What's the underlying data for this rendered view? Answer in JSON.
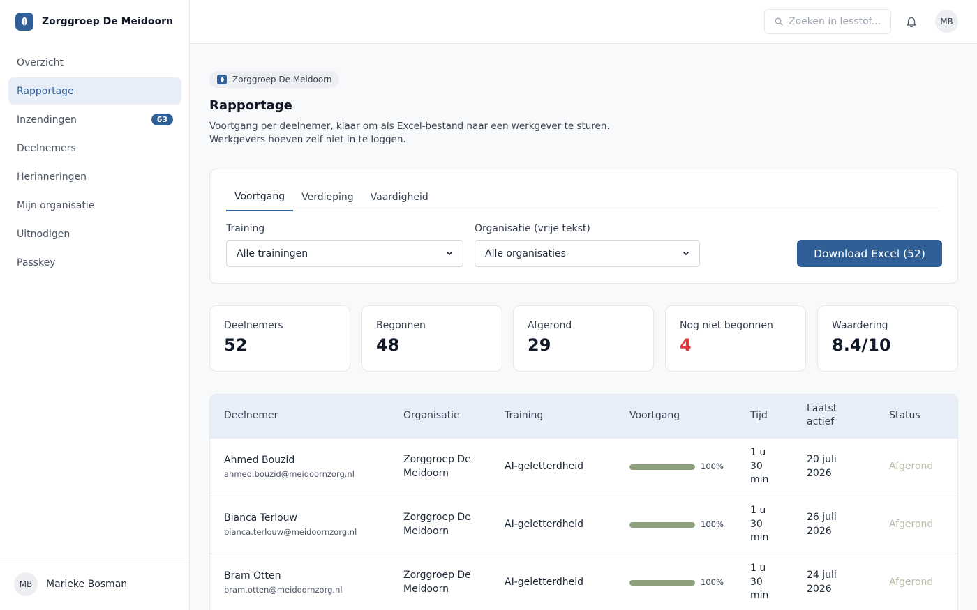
{
  "brand": {
    "name": "Zorggroep De Meidoorn"
  },
  "sidebar": {
    "items": [
      {
        "label": "Overzicht"
      },
      {
        "label": "Rapportage"
      },
      {
        "label": "Inzendingen",
        "badge": "63"
      },
      {
        "label": "Deelnemers"
      },
      {
        "label": "Herinneringen"
      },
      {
        "label": "Mijn organisatie"
      },
      {
        "label": "Uitnodigen"
      },
      {
        "label": "Passkey"
      }
    ],
    "user": {
      "initials": "MB",
      "name": "Marieke Bosman"
    }
  },
  "topbar": {
    "search_placeholder": "Zoeken in lesstof...",
    "avatar_initials": "MB"
  },
  "page": {
    "org_chip": "Zorggroep De Meidoorn",
    "title": "Rapportage",
    "desc_line1": "Voortgang per deelnemer, klaar om als Excel-bestand naar een werkgever te sturen.",
    "desc_line2": "Werkgevers hoeven zelf niet in te loggen."
  },
  "panel": {
    "tabs": [
      {
        "label": "Voortgang"
      },
      {
        "label": "Verdieping"
      },
      {
        "label": "Vaardigheid"
      }
    ],
    "training_label": "Training",
    "training_value": "Alle trainingen",
    "org_label": "Organisatie (vrije tekst)",
    "org_value": "Alle organisaties",
    "download_label": "Download Excel (52)"
  },
  "stats": [
    {
      "label": "Deelnemers",
      "value": "52"
    },
    {
      "label": "Begonnen",
      "value": "48"
    },
    {
      "label": "Afgerond",
      "value": "29"
    },
    {
      "label": "Nog niet begonnen",
      "value": "4"
    },
    {
      "label": "Waardering",
      "value": "8.4/10"
    }
  ],
  "table": {
    "headers": {
      "deelnemer": "Deelnemer",
      "organisatie": "Organisatie",
      "training": "Training",
      "voortgang": "Voortgang",
      "tijd": "Tijd",
      "laatst_1": "Laatst",
      "laatst_2": "actief",
      "status": "Status"
    },
    "rows": [
      {
        "name": "Ahmed Bouzid",
        "email": "ahmed.bouzid@meidoornzorg.nl",
        "org_1": "Zorggroep De",
        "org_2": "Meidoorn",
        "training": "AI-geletterdheid",
        "progress": 100,
        "progress_label": "100%",
        "time_1": "1 u",
        "time_2": "30",
        "time_3": "min",
        "last_1": "20 juli",
        "last_2": "2026",
        "status": "Afgerond"
      },
      {
        "name": "Bianca Terlouw",
        "email": "bianca.terlouw@meidoornzorg.nl",
        "org_1": "Zorggroep De",
        "org_2": "Meidoorn",
        "training": "AI-geletterdheid",
        "progress": 100,
        "progress_label": "100%",
        "time_1": "1 u",
        "time_2": "30",
        "time_3": "min",
        "last_1": "26 juli",
        "last_2": "2026",
        "status": "Afgerond"
      },
      {
        "name": "Bram Otten",
        "email": "bram.otten@meidoornzorg.nl",
        "org_1": "Zorggroep De",
        "org_2": "Meidoorn",
        "training": "AI-geletterdheid",
        "progress": 100,
        "progress_label": "100%",
        "time_1": "1 u",
        "time_2": "30",
        "time_3": "min",
        "last_1": "24 juli",
        "last_2": "2026",
        "status": "Afgerond"
      }
    ]
  },
  "colors": {
    "accent": "#2f5f96",
    "progress": "#8da07c",
    "warn": "#dc3b3b",
    "status_done": "#b8bfa8"
  }
}
